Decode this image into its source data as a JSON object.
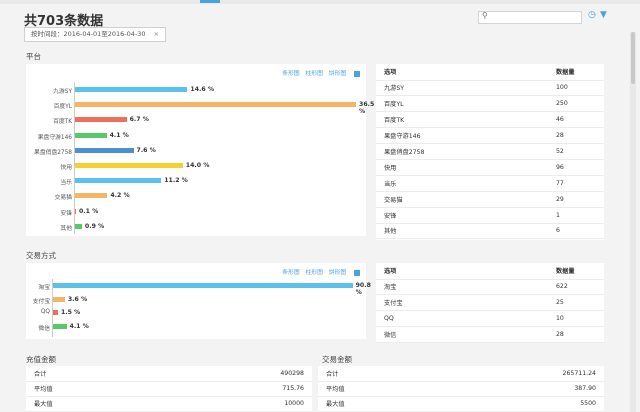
{
  "header": {
    "title": "共703条数据",
    "filter_text": "按时间段：2016-04-01至2016-04-30",
    "filter_close": "×",
    "search_icon": "search-icon",
    "right_icons": [
      "clock-icon",
      "filter-icon"
    ]
  },
  "platform": {
    "label": "平台",
    "chart_links": [
      "条形图",
      "柱形图",
      "饼形图"
    ],
    "chart_data": {
      "type": "bar",
      "categories": [
        "九游SY",
        "百度YL",
        "百度TK",
        "果盘守游146",
        "果盘俏盘2758",
        "快用",
        "当乐",
        "交易猫",
        "安锋",
        "其他"
      ],
      "values": [
        14.6,
        36.5,
        6.7,
        4.1,
        7.6,
        14.0,
        11.2,
        4.2,
        0.1,
        0.9
      ],
      "labels": [
        "14.6 %",
        "36.5 %",
        "6.7 %",
        "4.1 %",
        "7.6 %",
        "14.0 %",
        "11.2 %",
        "4.2 %",
        "0.1 %",
        "0.9 %"
      ],
      "colors": [
        "#5bc0eb",
        "#f5b562",
        "#ef6f5e",
        "#57c96b",
        "#4a90d9",
        "#f5d130",
        "#5bc0eb",
        "#f5b562",
        "#ef6f5e",
        "#57c96b"
      ]
    },
    "table": {
      "headers": [
        "选项",
        "数据量"
      ],
      "rows": [
        [
          "九游SY",
          "100"
        ],
        [
          "百度YL",
          "250"
        ],
        [
          "百度TK",
          "46"
        ],
        [
          "果盘守游146",
          "28"
        ],
        [
          "果盘俏盘2758",
          "52"
        ],
        [
          "快用",
          "96"
        ],
        [
          "当乐",
          "77"
        ],
        [
          "交易猫",
          "29"
        ],
        [
          "安锋",
          "1"
        ],
        [
          "其他",
          "6"
        ]
      ]
    }
  },
  "trade": {
    "label": "交易方式",
    "chart_links": [
      "条形图",
      "柱形图",
      "饼形图"
    ],
    "chart_data": {
      "type": "bar",
      "categories": [
        "淘宝",
        "支付宝",
        "QQ",
        "微信"
      ],
      "values": [
        90.8,
        3.6,
        1.5,
        4.1
      ],
      "labels": [
        "90.8 %",
        "3.6 %",
        "1.5 %",
        "4.1 %"
      ],
      "colors": [
        "#5bc0eb",
        "#f5b562",
        "#ef6f5e",
        "#57c96b"
      ]
    },
    "table": {
      "headers": [
        "选项",
        "数据量"
      ],
      "rows": [
        [
          "淘宝",
          "622"
        ],
        [
          "支付宝",
          "25"
        ],
        [
          "QQ",
          "10"
        ],
        [
          "微信",
          "28"
        ]
      ]
    }
  },
  "recharge": {
    "label": "充值金额",
    "rows": [
      [
        "合计",
        "490298"
      ],
      [
        "平均值",
        "715.76"
      ],
      [
        "最大值",
        "10000"
      ]
    ]
  },
  "trade_amount": {
    "label": "交易金额",
    "rows": [
      [
        "合计",
        "265711.24"
      ],
      [
        "平均值",
        "387.90"
      ],
      [
        "最大值",
        "5500"
      ]
    ]
  }
}
